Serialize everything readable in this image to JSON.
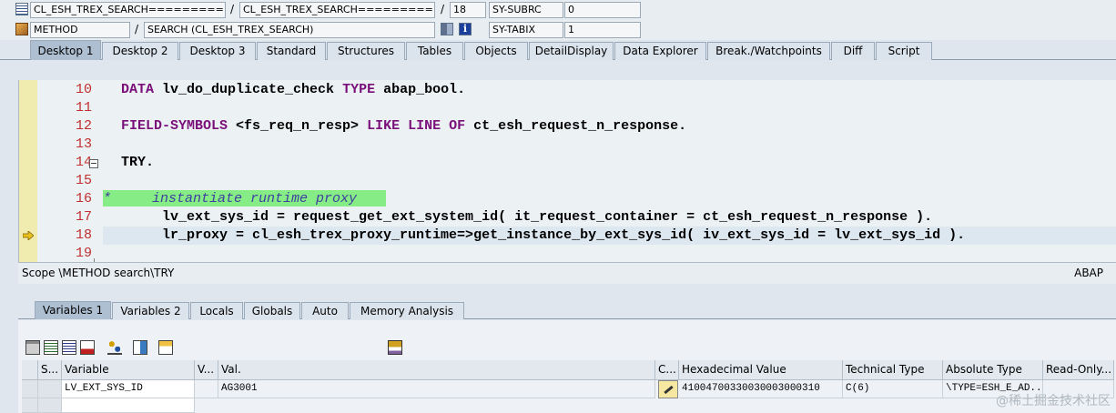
{
  "header": {
    "program_class": "CL_ESH_TREX_SEARCH============...",
    "include_class": "CL_ESH_TREX_SEARCH============...",
    "line": "18",
    "sysvar1_name": "SY-SUBRC",
    "sysvar1_value": "0",
    "event_type": "METHOD",
    "event_name": "SEARCH (CL_ESH_TREX_SEARCH)",
    "sysvar2_name": "SY-TABIX",
    "sysvar2_value": "1",
    "slash": "/"
  },
  "tabs": [
    "Desktop 1",
    "Desktop 2",
    "Desktop 3",
    "Standard",
    "Structures",
    "Tables",
    "Objects",
    "DetailDisplay",
    "Data Explorer",
    "Break./Watchpoints",
    "Diff",
    "Script"
  ],
  "code": {
    "line_numbers": [
      "10",
      "11",
      "12",
      "13",
      "14",
      "15",
      "16",
      "17",
      "18",
      "19"
    ],
    "lines": [
      {
        "kw1": "DATA",
        "t1": " lv_do_duplicate_check ",
        "kw2": "TYPE",
        "t2": " abap_bool."
      },
      {},
      {
        "kw1": "FIELD-SYMBOLS",
        "t1": " <fs_req_n_resp> ",
        "kw2": "LIKE LINE OF",
        "t2": " ct_esh_request_n_response."
      },
      {},
      {
        "t1": "TRY."
      },
      {},
      {
        "cm": "*     instantiate runtime proxy"
      },
      {
        "t1": "     lv_ext_sys_id = request_get_ext_system_id( it_request_container = ct_esh_request_n_response )."
      },
      {
        "t1": "     lr_proxy = cl_esh_trex_proxy_runtime=>get_instance_by_ext_sys_id( iv_ext_sys_id = lv_ext_sys_id )."
      },
      {}
    ]
  },
  "scope": {
    "text": "Scope \\METHOD search\\TRY",
    "lang": "ABAP"
  },
  "var_tabs": [
    "Variables 1",
    "Variables 2",
    "Locals",
    "Globals",
    "Auto",
    "Memory Analysis"
  ],
  "table": {
    "headers": [
      "S...",
      "Variable",
      "V...",
      "Val.",
      "C...",
      "Hexadecimal Value",
      "Technical Type",
      "Absolute Type",
      "Read-Only..."
    ],
    "row": {
      "variable": "LV_EXT_SYS_ID",
      "value": "AG3001",
      "hex": "41004700330030003000310",
      "tech_type": "C(6)",
      "abs_type": "\\TYPE=ESH_E_AD..."
    }
  },
  "watermark": "@稀土掘金技术社区"
}
